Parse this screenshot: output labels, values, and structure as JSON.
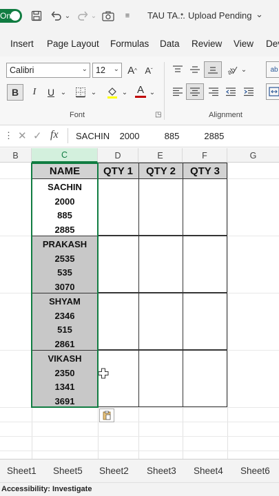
{
  "titlebar": {
    "autosave_toggle": "On",
    "title": "TAU TA...",
    "upload_status": "Upload Pending"
  },
  "menu": {
    "items": [
      "Insert",
      "Page Layout",
      "Formulas",
      "Data",
      "Review",
      "View",
      "Dev"
    ]
  },
  "ribbon": {
    "font_name": "Calibri",
    "font_size": "12",
    "grow_font": "A",
    "shrink_font": "A",
    "bold": "B",
    "italic": "I",
    "underline": "U",
    "font_color_glyph": "A",
    "font_group_label": "Font",
    "alignment_group_label": "Alignment",
    "wrap_glyph": "ab",
    "font_color_hex": "#c00000",
    "fill_color_hex": "#ffff00"
  },
  "formula_bar": {
    "fx": "fx",
    "content": "SACHIN    2000          885          2885"
  },
  "columns": [
    "B",
    "C",
    "D",
    "E",
    "F",
    "G"
  ],
  "table": {
    "headers": [
      "NAME",
      "QTY 1",
      "QTY 2",
      "QTY 3"
    ],
    "rows": [
      [
        "SACHIN",
        "2000",
        "885",
        "2885"
      ],
      [
        "PRAKASH",
        "2535",
        "535",
        "3070"
      ],
      [
        "SHYAM",
        "2346",
        "515",
        "2861"
      ],
      [
        "VIKASH",
        "2350",
        "1341",
        "3691"
      ]
    ]
  },
  "sheets": [
    "Sheet1",
    "Sheet5",
    "Sheet2",
    "Sheet3",
    "Sheet4",
    "Sheet6"
  ],
  "status": {
    "accessibility": "Accessibility: Investigate"
  },
  "colors": {
    "accent": "#107c41",
    "header_fill": "#d2d2d2",
    "highlight_fill": "#c8c8c8"
  }
}
